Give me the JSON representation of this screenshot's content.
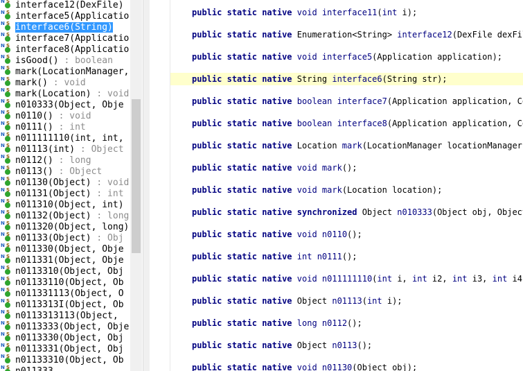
{
  "outline": {
    "selected_index": 2,
    "items": [
      {
        "label": "interface12(DexFile)",
        "ret": ""
      },
      {
        "label": "interface5(Applicatio",
        "ret": ""
      },
      {
        "label": "interface6(String)",
        "ret": " : "
      },
      {
        "label": "interface7(Applicatio",
        "ret": ""
      },
      {
        "label": "interface8(Applicatio",
        "ret": ""
      },
      {
        "label": "isGood()",
        "ret": " : boolean"
      },
      {
        "label": "mark(LocationManager,",
        "ret": ""
      },
      {
        "label": "mark()",
        "ret": " : void"
      },
      {
        "label": "mark(Location)",
        "ret": " : void"
      },
      {
        "label": "n010333(Object, Obje",
        "ret": ""
      },
      {
        "label": "n0110()",
        "ret": " : void"
      },
      {
        "label": "n0111()",
        "ret": " : int"
      },
      {
        "label": "n011111110(int, int,",
        "ret": ""
      },
      {
        "label": "n01113(int)",
        "ret": " : Object"
      },
      {
        "label": "n0112()",
        "ret": " : long"
      },
      {
        "label": "n0113()",
        "ret": " : Object"
      },
      {
        "label": "n01130(Object)",
        "ret": " : void"
      },
      {
        "label": "n01131(Object)",
        "ret": " : int"
      },
      {
        "label": "n011310(Object, int)",
        "ret": ""
      },
      {
        "label": "n01132(Object)",
        "ret": " : long"
      },
      {
        "label": "n011320(Object, long)",
        "ret": ""
      },
      {
        "label": "n01133(Object)",
        "ret": " : Obj"
      },
      {
        "label": "n011330(Object, Obje",
        "ret": ""
      },
      {
        "label": "n011331(Object, Obje",
        "ret": ""
      },
      {
        "label": "n0113310(Object, Obj",
        "ret": ""
      },
      {
        "label": "n01133110(Object, Ob",
        "ret": ""
      },
      {
        "label": "n011331113(Object, O",
        "ret": ""
      },
      {
        "label": "n0113313I(Object, Ob",
        "ret": ""
      },
      {
        "label": "n0113313113(Object,",
        "ret": ""
      },
      {
        "label": "n0113333(Object, Obje",
        "ret": ""
      },
      {
        "label": "n0113330(Object, Obj",
        "ret": ""
      },
      {
        "label": "n0113331(Object, Obj",
        "ret": ""
      },
      {
        "label": "n01133310(Object, Ob",
        "ret": ""
      },
      {
        "label": "n011333...",
        "ret": ""
      }
    ]
  },
  "editor": {
    "highlight_index": 3,
    "lines": [
      [
        {
          "t": "public",
          "c": "kw"
        },
        {
          "t": " "
        },
        {
          "t": "static",
          "c": "kw"
        },
        {
          "t": " "
        },
        {
          "t": "native",
          "c": "kw"
        },
        {
          "t": " "
        },
        {
          "t": "void",
          "c": "ty"
        },
        {
          "t": " "
        },
        {
          "t": "interface11",
          "c": "mn"
        },
        {
          "t": "("
        },
        {
          "t": "int",
          "c": "pm"
        },
        {
          "t": " i);"
        }
      ],
      [
        {
          "t": "public",
          "c": "kw"
        },
        {
          "t": " "
        },
        {
          "t": "static",
          "c": "kw"
        },
        {
          "t": " "
        },
        {
          "t": "native",
          "c": "kw"
        },
        {
          "t": " Enumeration<String> "
        },
        {
          "t": "interface12",
          "c": "mn"
        },
        {
          "t": "(DexFile dexFile"
        }
      ],
      [
        {
          "t": "public",
          "c": "kw"
        },
        {
          "t": " "
        },
        {
          "t": "static",
          "c": "kw"
        },
        {
          "t": " "
        },
        {
          "t": "native",
          "c": "kw"
        },
        {
          "t": " "
        },
        {
          "t": "void",
          "c": "ty"
        },
        {
          "t": " "
        },
        {
          "t": "interface5",
          "c": "mn"
        },
        {
          "t": "(Application application);"
        }
      ],
      [
        {
          "t": "public",
          "c": "kw"
        },
        {
          "t": " "
        },
        {
          "t": "static",
          "c": "kw"
        },
        {
          "t": " "
        },
        {
          "t": "native",
          "c": "kw"
        },
        {
          "t": " String "
        },
        {
          "t": "interface6",
          "c": "mn"
        },
        {
          "t": "(String str);"
        }
      ],
      [
        {
          "t": "public",
          "c": "kw"
        },
        {
          "t": " "
        },
        {
          "t": "static",
          "c": "kw"
        },
        {
          "t": " "
        },
        {
          "t": "native",
          "c": "kw"
        },
        {
          "t": " "
        },
        {
          "t": "boolean",
          "c": "ty"
        },
        {
          "t": " "
        },
        {
          "t": "interface7",
          "c": "mn"
        },
        {
          "t": "(Application application, Con"
        }
      ],
      [
        {
          "t": "public",
          "c": "kw"
        },
        {
          "t": " "
        },
        {
          "t": "static",
          "c": "kw"
        },
        {
          "t": " "
        },
        {
          "t": "native",
          "c": "kw"
        },
        {
          "t": " "
        },
        {
          "t": "boolean",
          "c": "ty"
        },
        {
          "t": " "
        },
        {
          "t": "interface8",
          "c": "mn"
        },
        {
          "t": "(Application application, Con"
        }
      ],
      [
        {
          "t": "public",
          "c": "kw"
        },
        {
          "t": " "
        },
        {
          "t": "static",
          "c": "kw"
        },
        {
          "t": " "
        },
        {
          "t": "native",
          "c": "kw"
        },
        {
          "t": " Location "
        },
        {
          "t": "mark",
          "c": "mn"
        },
        {
          "t": "(LocationManager locationManager, S"
        }
      ],
      [
        {
          "t": "public",
          "c": "kw"
        },
        {
          "t": " "
        },
        {
          "t": "static",
          "c": "kw"
        },
        {
          "t": " "
        },
        {
          "t": "native",
          "c": "kw"
        },
        {
          "t": " "
        },
        {
          "t": "void",
          "c": "ty"
        },
        {
          "t": " "
        },
        {
          "t": "mark",
          "c": "mn"
        },
        {
          "t": "();"
        }
      ],
      [
        {
          "t": "public",
          "c": "kw"
        },
        {
          "t": " "
        },
        {
          "t": "static",
          "c": "kw"
        },
        {
          "t": " "
        },
        {
          "t": "native",
          "c": "kw"
        },
        {
          "t": " "
        },
        {
          "t": "void",
          "c": "ty"
        },
        {
          "t": " "
        },
        {
          "t": "mark",
          "c": "mn"
        },
        {
          "t": "(Location location);"
        }
      ],
      [
        {
          "t": "public",
          "c": "kw"
        },
        {
          "t": " "
        },
        {
          "t": "static",
          "c": "kw"
        },
        {
          "t": " "
        },
        {
          "t": "native",
          "c": "kw"
        },
        {
          "t": " "
        },
        {
          "t": "synchronized",
          "c": "kw"
        },
        {
          "t": " Object "
        },
        {
          "t": "n010333",
          "c": "mn"
        },
        {
          "t": "(Object obj, Object o"
        }
      ],
      [
        {
          "t": "public",
          "c": "kw"
        },
        {
          "t": " "
        },
        {
          "t": "static",
          "c": "kw"
        },
        {
          "t": " "
        },
        {
          "t": "native",
          "c": "kw"
        },
        {
          "t": " "
        },
        {
          "t": "void",
          "c": "ty"
        },
        {
          "t": " "
        },
        {
          "t": "n0110",
          "c": "mn"
        },
        {
          "t": "();"
        }
      ],
      [
        {
          "t": "public",
          "c": "kw"
        },
        {
          "t": " "
        },
        {
          "t": "static",
          "c": "kw"
        },
        {
          "t": " "
        },
        {
          "t": "native",
          "c": "kw"
        },
        {
          "t": " "
        },
        {
          "t": "int",
          "c": "ty"
        },
        {
          "t": " "
        },
        {
          "t": "n0111",
          "c": "mn"
        },
        {
          "t": "();"
        }
      ],
      [
        {
          "t": "public",
          "c": "kw"
        },
        {
          "t": " "
        },
        {
          "t": "static",
          "c": "kw"
        },
        {
          "t": " "
        },
        {
          "t": "native",
          "c": "kw"
        },
        {
          "t": " "
        },
        {
          "t": "void",
          "c": "ty"
        },
        {
          "t": " "
        },
        {
          "t": "n011111110",
          "c": "mn"
        },
        {
          "t": "("
        },
        {
          "t": "int",
          "c": "pm"
        },
        {
          "t": " i, "
        },
        {
          "t": "int",
          "c": "pm"
        },
        {
          "t": " i2, "
        },
        {
          "t": "int",
          "c": "pm"
        },
        {
          "t": " i3, "
        },
        {
          "t": "int",
          "c": "pm"
        },
        {
          "t": " i4, "
        }
      ],
      [
        {
          "t": "public",
          "c": "kw"
        },
        {
          "t": " "
        },
        {
          "t": "static",
          "c": "kw"
        },
        {
          "t": " "
        },
        {
          "t": "native",
          "c": "kw"
        },
        {
          "t": " Object "
        },
        {
          "t": "n01113",
          "c": "mn"
        },
        {
          "t": "("
        },
        {
          "t": "int",
          "c": "pm"
        },
        {
          "t": " i);"
        }
      ],
      [
        {
          "t": "public",
          "c": "kw"
        },
        {
          "t": " "
        },
        {
          "t": "static",
          "c": "kw"
        },
        {
          "t": " "
        },
        {
          "t": "native",
          "c": "kw"
        },
        {
          "t": " "
        },
        {
          "t": "long",
          "c": "ty"
        },
        {
          "t": " "
        },
        {
          "t": "n0112",
          "c": "mn"
        },
        {
          "t": "();"
        }
      ],
      [
        {
          "t": "public",
          "c": "kw"
        },
        {
          "t": " "
        },
        {
          "t": "static",
          "c": "kw"
        },
        {
          "t": " "
        },
        {
          "t": "native",
          "c": "kw"
        },
        {
          "t": " Object "
        },
        {
          "t": "n0113",
          "c": "mn"
        },
        {
          "t": "();"
        }
      ],
      [
        {
          "t": "public",
          "c": "kw"
        },
        {
          "t": " "
        },
        {
          "t": "static",
          "c": "kw"
        },
        {
          "t": " "
        },
        {
          "t": "native",
          "c": "kw"
        },
        {
          "t": " "
        },
        {
          "t": "void",
          "c": "ty"
        },
        {
          "t": " "
        },
        {
          "t": "n01130",
          "c": "mn"
        },
        {
          "t": "(Object obj);"
        }
      ]
    ]
  }
}
